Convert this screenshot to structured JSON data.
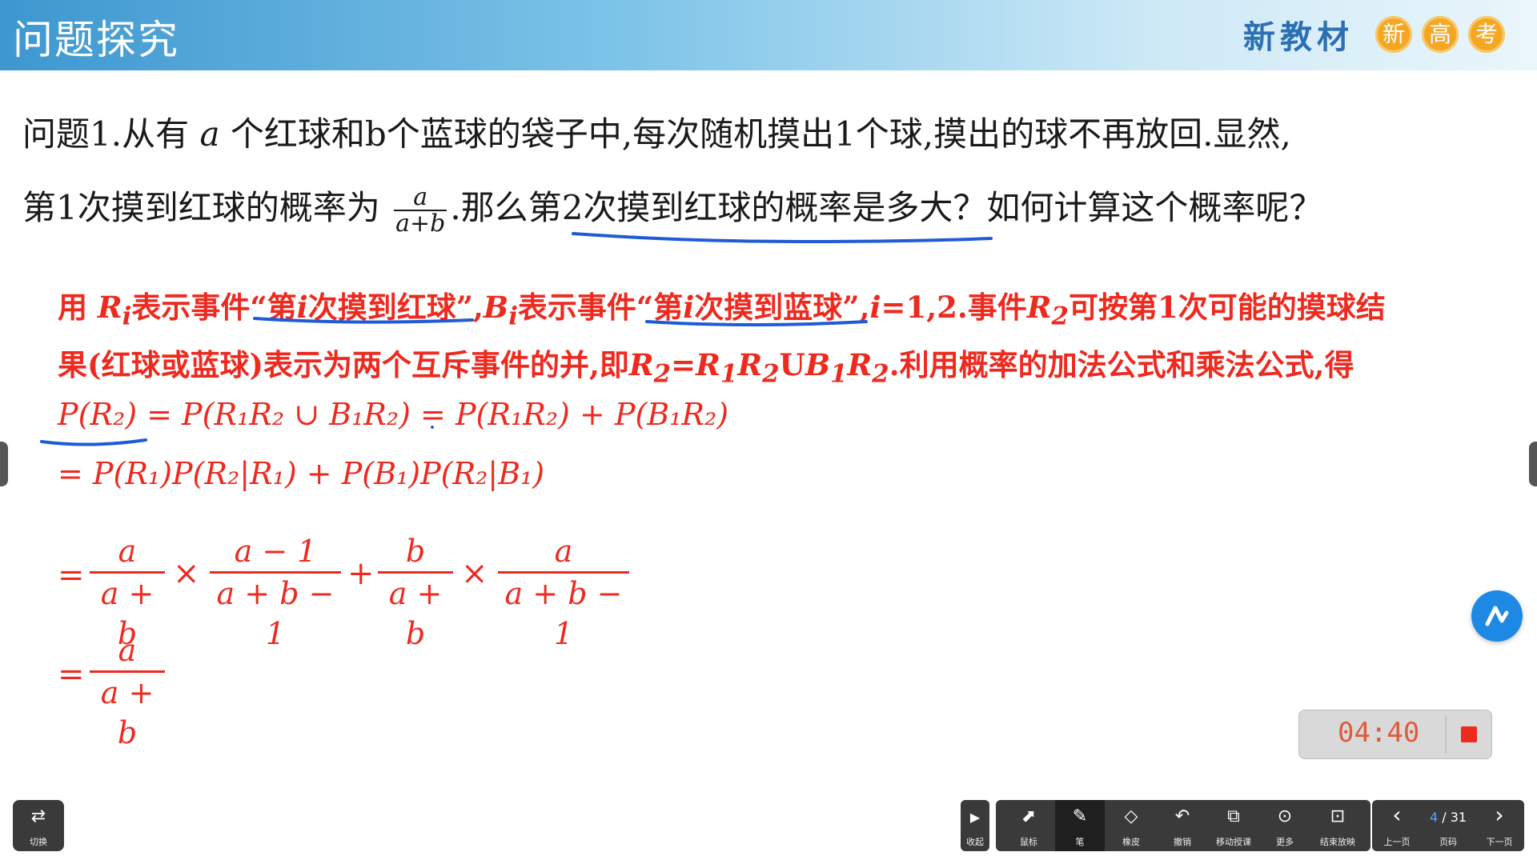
{
  "header": {
    "title": "问题探究",
    "brand": "新教材",
    "badges": [
      "新",
      "高",
      "考"
    ]
  },
  "problem": {
    "line1_a": "问题1.从有",
    "line1_var": "a",
    "line1_b": "个红球和b个蓝球的袋子中,每次随机摸出1个球,摸出的球不再放回.显然,",
    "line2_a": "第1次摸到红球的概率为",
    "frac_num": "a",
    "frac_den": "a+b",
    "line2_b": ".那么",
    "line2_c": "第2次摸到红球的概率是多大？如何计算这个概率呢？"
  },
  "solution": {
    "l1a": "用",
    "l1b": "表示事件",
    "q1": "“第",
    "i_var": "i",
    "q1_end": "次摸到红球”",
    "l1c": ",",
    "l1d": "表示事件",
    "q2": "“第",
    "q2_end": "次摸到蓝球”",
    "l1e": ",",
    "l1f": "=1,2.事件",
    "l1g": "可按第1次可能的摸球结",
    "l2a": "果(红球或蓝球)表示为两个互斥事件的并,即",
    "l2b": "=",
    "l2c": ".利用概率的加法公式和乘法公式,得",
    "R": "R",
    "B": "B",
    "sub_i": "i",
    "sub_1": "1",
    "sub_2": "2",
    "U": "U",
    "eq1": "P(R₂) = P(R₁R₂ ∪ B₁R₂) = P(R₁R₂) + P(B₁R₂)",
    "eq2": "= P(R₁)P(R₂|R₁) + P(B₁)P(R₂|B₁)",
    "eq_sign": "=",
    "times": "×",
    "plus": "+",
    "f1": {
      "num": "a",
      "den": "a + b"
    },
    "f2": {
      "num": "a − 1",
      "den": "a + b − 1"
    },
    "f3": {
      "num": "b",
      "den": "a + b"
    },
    "f4": {
      "num": "a",
      "den": "a + b − 1"
    },
    "f5": {
      "num": "a",
      "den": "a + b"
    }
  },
  "timer": {
    "time": "04:40"
  },
  "toolbar": {
    "switch": {
      "icon": "⇄",
      "label": "切换"
    },
    "collapse": {
      "icon": "▶",
      "label": "收起"
    },
    "tools": [
      {
        "icon": "⬈",
        "label": "鼠标"
      },
      {
        "icon": "✎",
        "label": "笔"
      },
      {
        "icon": "◇",
        "label": "橡皮"
      },
      {
        "icon": "↶",
        "label": "撤销"
      },
      {
        "icon": "⧉",
        "label": "移动授课"
      },
      {
        "icon": "⊙",
        "label": "更多"
      },
      {
        "icon": "⊡",
        "label": "结束放映"
      }
    ],
    "prev": {
      "icon": "‹",
      "label": "上一页"
    },
    "page": {
      "current": "4",
      "sep": " / ",
      "total": "31",
      "label": "页码"
    },
    "next": {
      "icon": "›",
      "label": "下一页"
    }
  },
  "colors": {
    "accent_red": "#ee2a1f",
    "ink_blue": "#1e5bd6",
    "banner_blue": "#3d97cf",
    "fab_blue": "#1e88e5"
  }
}
